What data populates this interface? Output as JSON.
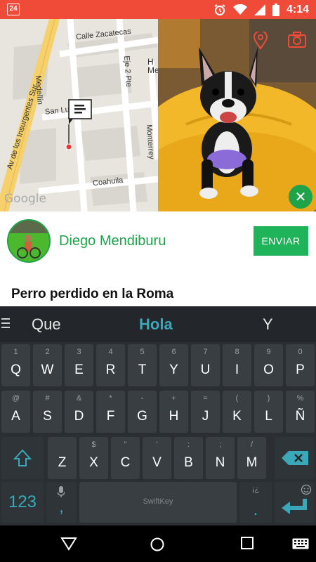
{
  "status_bar": {
    "app_icon_text": "24",
    "time": "4:14",
    "icons": [
      "alarm-icon",
      "wifi-icon",
      "signal-icon",
      "battery-icon"
    ]
  },
  "map": {
    "streets": [
      "Calle Zacatecas",
      "Medellín",
      "Eje 2 Pte",
      "Av de los Insurgentes Sur",
      "San Luis Potosí",
      "Monterrey",
      "Coahuila"
    ],
    "street_partial": [
      "San Lu",
      "Potosí"
    ],
    "place_partial": "H\nMe",
    "attribution": "Google",
    "marker_icon": "message-pin-icon"
  },
  "photo": {
    "icons": [
      "location-pin-icon",
      "camera-icon"
    ],
    "close_icon": "close-icon",
    "close_glyph": "✕"
  },
  "user": {
    "name": "Diego Mendiburu",
    "send_label": "ENVIAR"
  },
  "post": {
    "title": "Perro perdido en la Roma"
  },
  "keyboard": {
    "suggestions": [
      "Que",
      "Hola",
      "Y"
    ],
    "row1": [
      {
        "main": "Q",
        "sub": "1"
      },
      {
        "main": "W",
        "sub": "2"
      },
      {
        "main": "E",
        "sub": "3"
      },
      {
        "main": "R",
        "sub": "4"
      },
      {
        "main": "T",
        "sub": "5"
      },
      {
        "main": "Y",
        "sub": "6"
      },
      {
        "main": "U",
        "sub": "7"
      },
      {
        "main": "I",
        "sub": "8"
      },
      {
        "main": "O",
        "sub": "9"
      },
      {
        "main": "P",
        "sub": "0"
      }
    ],
    "row2": [
      {
        "main": "A",
        "sub": "@"
      },
      {
        "main": "S",
        "sub": "#"
      },
      {
        "main": "D",
        "sub": "&"
      },
      {
        "main": "F",
        "sub": "*"
      },
      {
        "main": "G",
        "sub": "-"
      },
      {
        "main": "H",
        "sub": "+"
      },
      {
        "main": "J",
        "sub": "="
      },
      {
        "main": "K",
        "sub": "("
      },
      {
        "main": "L",
        "sub": ")"
      },
      {
        "main": "Ñ",
        "sub": "%"
      }
    ],
    "row3": [
      {
        "main": "Z",
        "sub": ""
      },
      {
        "main": "X",
        "sub": "$"
      },
      {
        "main": "C",
        "sub": "\""
      },
      {
        "main": "V",
        "sub": "'"
      },
      {
        "main": "B",
        "sub": ":"
      },
      {
        "main": "N",
        "sub": ";"
      },
      {
        "main": "M",
        "sub": "/"
      }
    ],
    "numbers_label": "123",
    "comma": ",",
    "space_brand": "SwiftKey",
    "period": ".",
    "period_sub": "¡¿",
    "shift_icon": "shift-icon",
    "backspace_icon": "backspace-icon",
    "enter_icon": "enter-icon",
    "mic_icon": "mic-icon",
    "emoji_icon": "emoji-icon"
  },
  "nav": {
    "icons": [
      "back-icon",
      "home-icon",
      "recents-icon",
      "keyboard-switch-icon"
    ]
  }
}
